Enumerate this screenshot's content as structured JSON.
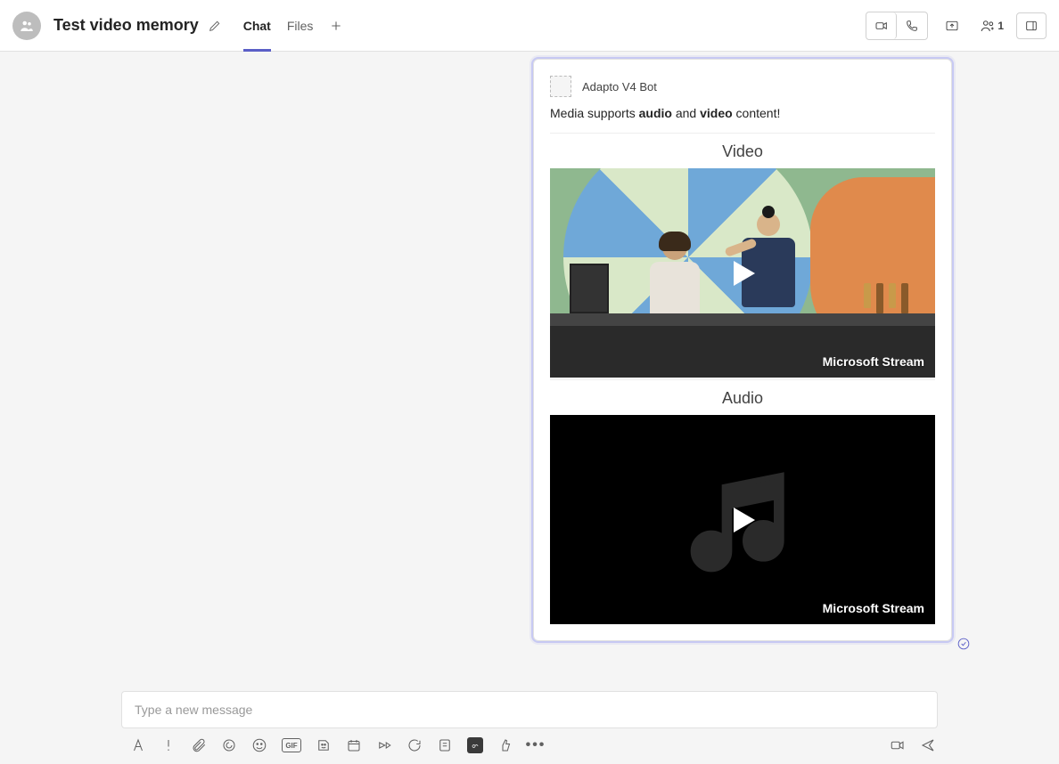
{
  "header": {
    "title": "Test video memory",
    "tabs": [
      {
        "label": "Chat",
        "active": true
      },
      {
        "label": "Files",
        "active": false
      }
    ],
    "participants_count": "1"
  },
  "message": {
    "bot_name": "Adapto V4 Bot",
    "text_prefix": "Media supports ",
    "text_bold1": "audio",
    "text_mid": " and ",
    "text_bold2": "video",
    "text_suffix": " content!",
    "video_section_title": "Video",
    "audio_section_title": "Audio",
    "video_source": "Microsoft Stream",
    "audio_source": "Microsoft Stream"
  },
  "compose": {
    "placeholder": "Type a new message",
    "gif_label": "GIF"
  }
}
